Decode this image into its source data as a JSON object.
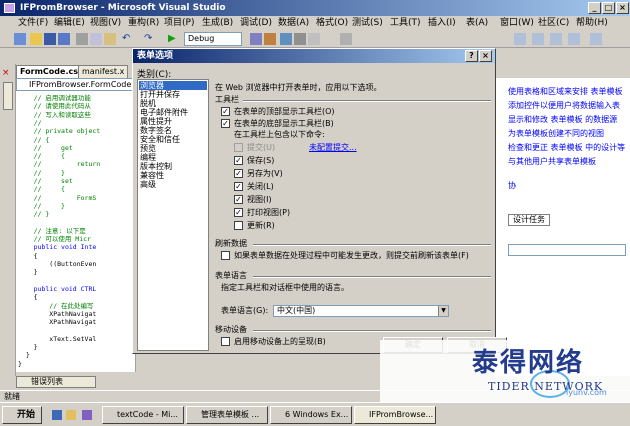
{
  "window": {
    "title": "IFPromBrowser - Microsoft Visual Studio"
  },
  "menu": [
    "文件(F)",
    "编辑(E)",
    "视图(V)",
    "重构(R)",
    "项目(P)",
    "生成(B)",
    "调试(D)",
    "数据(A)",
    "格式(O)",
    "测试(S)",
    "工具(T)",
    "插入(I)",
    "表(A)",
    "窗口(W)",
    "社区(C)",
    "帮助(H)"
  ],
  "toolbar": {
    "debug_config": "Debug"
  },
  "editor": {
    "tabs": [
      "FormCode.cs",
      "manifest.x"
    ],
    "class_combo": "IFPromBrowser.FormCode",
    "lines": [
      {
        "t": "    // 启用调试器功能",
        "c": "cm"
      },
      {
        "t": "    // 请使用此代码从",
        "c": "cm"
      },
      {
        "t": "    // 写入和读取这些",
        "c": "cm"
      },
      {
        "t": "    //",
        "c": "cm"
      },
      {
        "t": "    // private object",
        "c": "cm"
      },
      {
        "t": "    // {",
        "c": "cm"
      },
      {
        "t": "    //     get",
        "c": "cm"
      },
      {
        "t": "    //     {",
        "c": "cm"
      },
      {
        "t": "    //         return",
        "c": "cm"
      },
      {
        "t": "    //     }",
        "c": "cm"
      },
      {
        "t": "    //     set",
        "c": "cm"
      },
      {
        "t": "    //     {",
        "c": "cm"
      },
      {
        "t": "    //         FormS",
        "c": "cm"
      },
      {
        "t": "    //     }",
        "c": "cm"
      },
      {
        "t": "    // }",
        "c": "cm"
      },
      {
        "t": "",
        "c": "nm"
      },
      {
        "t": "    // 注意: 以下是",
        "c": "cm"
      },
      {
        "t": "    // 可以使用 Micr",
        "c": "cm"
      },
      {
        "t": "    public void Inte",
        "c": "kw"
      },
      {
        "t": "    {",
        "c": "nm"
      },
      {
        "t": "        ((ButtonEven",
        "c": "nm"
      },
      {
        "t": "    }",
        "c": "nm"
      },
      {
        "t": "",
        "c": "nm"
      },
      {
        "t": "    public void CTRL",
        "c": "kw"
      },
      {
        "t": "    {",
        "c": "nm"
      },
      {
        "t": "        // 在此处编写",
        "c": "cm"
      },
      {
        "t": "        XPathNavigat",
        "c": "nm"
      },
      {
        "t": "        XPathNavigat",
        "c": "nm"
      },
      {
        "t": "",
        "c": "nm"
      },
      {
        "t": "        xText.SetVal",
        "c": "nm"
      },
      {
        "t": "    }",
        "c": "nm"
      },
      {
        "t": "  }",
        "c": "nm"
      },
      {
        "t": "}",
        "c": "nm"
      }
    ]
  },
  "right_pane": {
    "lines": [
      "使用表格和区域来安排 表单模板",
      "添加控件以便用户将数据输入表",
      "显示和修改 表单模板 的数据源",
      "为表单模板创建不同的视图",
      "检查和更正 表单模板 中的设计等",
      "与其他用户共享表单模板"
    ],
    "extra": "协",
    "design_tab": "设计任务"
  },
  "bottom": {
    "error_list_tab": "错误列表",
    "status": "就绪"
  },
  "taskbar": {
    "start": "开始",
    "buttons": [
      "textCode - Mi...",
      "管理表单模板 ...",
      "6 Windows Ex...",
      "IFPromBrowse..."
    ]
  },
  "dialog": {
    "title": "表单选项",
    "help_glyph": "?",
    "close_glyph": "×",
    "categories_label": "类别(C):",
    "categories": [
      "浏览器",
      "打开并保存",
      "脱机",
      "电子邮件附件",
      "属性提升",
      "数字签名",
      "安全和信任",
      "预览",
      "编程",
      "版本控制",
      "兼容性",
      "高级"
    ],
    "selected_category": 0,
    "intro": "在 Web 浏览器中打开表单时，应用以下选项。",
    "toolbar_section": "工具栏",
    "show_top_toolbar": "在表单的顶部显示工具栏(O)",
    "show_bottom_toolbar": "在表单的底部显示工具栏(B)",
    "include_label": "在工具栏上包含以下命令:",
    "commands": [
      {
        "label": "提交(U)",
        "checked": false,
        "disabled": true
      },
      {
        "label": "保存(S)",
        "checked": true,
        "disabled": false
      },
      {
        "label": "另存为(V)",
        "checked": true,
        "disabled": false
      },
      {
        "label": "关闭(L)",
        "checked": true,
        "disabled": false
      },
      {
        "label": "视图(I)",
        "checked": true,
        "disabled": false
      },
      {
        "label": "打印视图(P)",
        "checked": true,
        "disabled": false
      },
      {
        "label": "更新(R)",
        "checked": false,
        "disabled": false
      }
    ],
    "submit_link": "未配置提交...",
    "refresh_section": "刷新数据",
    "refresh_option": "如果表单数据在处理过程中可能发生更改，则提交前刷新该表单(F)",
    "lang_section": "表单语言",
    "lang_hint": "指定工具栏和对话框中使用的语言。",
    "lang_label": "表单语言(G):",
    "lang_value": "中文(中国)",
    "mobile_section": "移动设备",
    "mobile_option": "启用移动设备上的呈现(B)",
    "ok": "确定",
    "cancel": "取消"
  },
  "watermark": {
    "brand": "泰得网络",
    "brand_en": "TIDER NETWORK",
    "url": "iyunv.com"
  }
}
